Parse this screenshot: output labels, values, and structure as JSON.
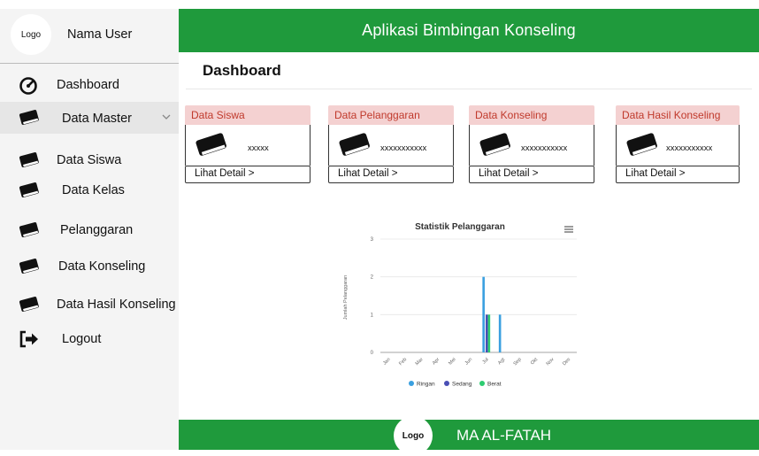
{
  "sidebar": {
    "logo": "Logo",
    "user_name": "Nama User",
    "items": [
      {
        "label": "Dashboard",
        "icon": "speedometer-icon"
      },
      {
        "label": "Data Master",
        "icon": "book-icon"
      },
      {
        "label": "Data Siswa",
        "icon": "book-icon"
      },
      {
        "label": "Data Kelas",
        "icon": "book-icon"
      },
      {
        "label": "Pelanggaran",
        "icon": "book-icon"
      },
      {
        "label": "Data Konseling",
        "icon": "book-icon"
      },
      {
        "label": "Data Hasil Konseling",
        "icon": "book-icon"
      },
      {
        "label": "Logout",
        "icon": "logout-icon"
      }
    ]
  },
  "header": {
    "title": "Aplikasi Bimbingan Konseling"
  },
  "main": {
    "page_title": "Dashboard",
    "cards": [
      {
        "title": "Data Siswa",
        "value": "xxxxx",
        "detail": "Lihat Detail >"
      },
      {
        "title": "Data Pelanggaran",
        "value": "xxxxxxxxxxx",
        "detail": "Lihat Detail >"
      },
      {
        "title": "Data Konseling",
        "value": "xxxxxxxxxxx",
        "detail": "Lihat Detail >"
      },
      {
        "title": "Data Hasil Konseling",
        "value": "xxxxxxxxxxx",
        "detail": "Lihat Detail >"
      }
    ]
  },
  "chart_data": {
    "type": "bar",
    "title": "Statistik Pelanggaran",
    "ylabel": "Jumlah Pelanggaran",
    "xlabel": "",
    "ylim": [
      0,
      3
    ],
    "yticks": [
      "0",
      "1",
      "2",
      "3"
    ],
    "categories": [
      "Jan",
      "Feb",
      "Mar",
      "Apr",
      "Mei",
      "Jun",
      "Jul",
      "Agt",
      "Sep",
      "Okt",
      "Nov",
      "Des"
    ],
    "series": [
      {
        "name": "Ringan",
        "color": "#3aa0e0",
        "values": [
          0,
          0,
          0,
          0,
          0,
          0,
          2,
          1,
          0,
          0,
          0,
          0
        ]
      },
      {
        "name": "Sedang",
        "color": "#4a4fb5",
        "values": [
          0,
          0,
          0,
          0,
          0,
          0,
          1,
          0,
          0,
          0,
          0,
          0
        ]
      },
      {
        "name": "Berat",
        "color": "#2ecc71",
        "values": [
          0,
          0,
          0,
          0,
          0,
          0,
          1,
          0,
          0,
          0,
          0,
          0
        ]
      }
    ],
    "legend": "bottom",
    "grid": true
  },
  "footer": {
    "logo": "Logo",
    "school": "MA AL-FATAH"
  },
  "colors": {
    "primary": "#1f9a3c",
    "card_header": "#f4d1d1",
    "card_title": "#c0392b"
  }
}
